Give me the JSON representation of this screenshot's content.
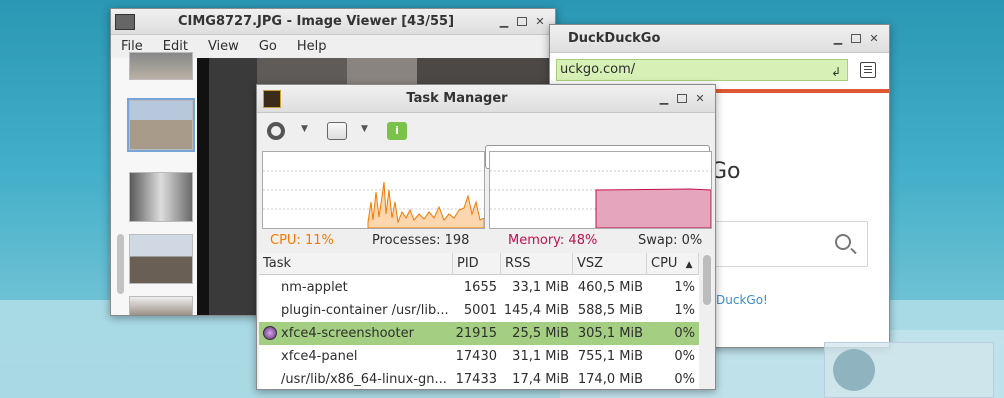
{
  "viewer": {
    "title": "CIMG8727.JPG - Image Viewer [43/55]",
    "menu": [
      "File",
      "Edit",
      "View",
      "Go",
      "Help"
    ]
  },
  "browser": {
    "title": "DuckDuckGo",
    "url": "uckgo.com/",
    "logo_fragment": "Go",
    "link_fragment": "DuckGo!"
  },
  "taskmanager": {
    "title": "Task Manager",
    "cpu": "CPU: 11%",
    "processes": "Processes: 198",
    "memory": "Memory: 48%",
    "swap": "Swap: 0%",
    "colors": {
      "cpu": "#f57900",
      "memory": "#c4104f",
      "selected_row": "#a4cf83"
    },
    "columns": [
      "Task",
      "PID",
      "RSS",
      "VSZ",
      "CPU"
    ],
    "rows": [
      {
        "task": "nm-applet",
        "pid": "1655",
        "rss": "33,1 MiB",
        "vsz": "460,5 MiB",
        "cpu": "1%"
      },
      {
        "task": "plugin-container /usr/lib...",
        "pid": "5001",
        "rss": "145,4 MiB",
        "vsz": "588,5 MiB",
        "cpu": "1%"
      },
      {
        "task": "xfce4-screenshooter",
        "pid": "21915",
        "rss": "25,5 MiB",
        "vsz": "305,1 MiB",
        "cpu": "0%"
      },
      {
        "task": "xfce4-panel",
        "pid": "17430",
        "rss": "31,1 MiB",
        "vsz": "755,1 MiB",
        "cpu": "0%"
      },
      {
        "task": "/usr/lib/x86_64-linux-gn...",
        "pid": "17433",
        "rss": "17,4 MiB",
        "vsz": "174,0 MiB",
        "cpu": "0%"
      }
    ]
  }
}
